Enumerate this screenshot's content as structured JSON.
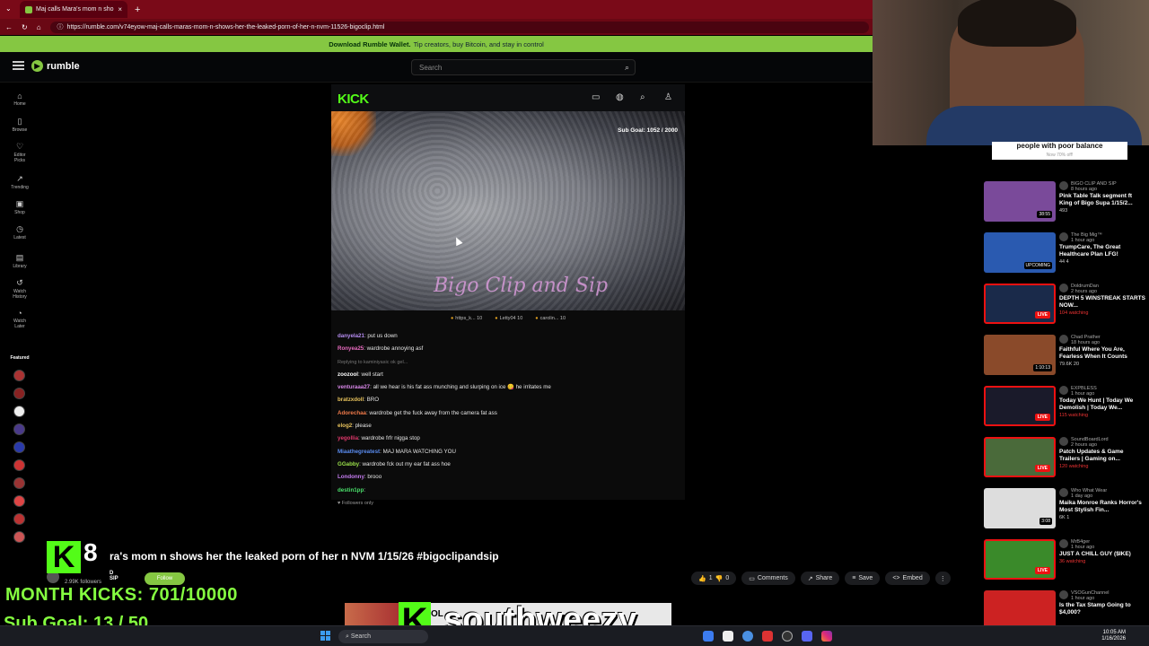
{
  "browser": {
    "tab_title": "Maj calls Mara's mom n sho",
    "url": "https://rumble.com/v74eyow-maj-calls-maras-mom-n-shows-her-the-leaked-porn-of-her-n-nvm-11526-bigoclip.html"
  },
  "banner": {
    "bold": "Download Rumble Wallet.",
    "text": "Tip creators, buy Bitcoin, and stay in control"
  },
  "header": {
    "logo": "rumble",
    "search_placeholder": "Search"
  },
  "sidebar": {
    "items": [
      {
        "label": "Home",
        "icon": "home-icon"
      },
      {
        "label": "Browse",
        "icon": "browse-icon"
      },
      {
        "label": "Editor Picks",
        "icon": "editor-picks-icon"
      },
      {
        "label": "Trending",
        "icon": "trending-icon"
      },
      {
        "label": "Shop",
        "icon": "shop-icon"
      },
      {
        "label": "Latest",
        "icon": "latest-icon"
      },
      {
        "label": "Library",
        "icon": "library-icon"
      },
      {
        "label": "Watch History",
        "icon": "history-icon"
      },
      {
        "label": "Watch Later",
        "icon": "watch-later-icon"
      }
    ],
    "featured": "Featured"
  },
  "player": {
    "kick_logo": "KICK",
    "sub_goal": "Sub Goal:  1052 / 2000",
    "watermark": "Bigo Clip and Sip",
    "gifters": [
      "https_k... 10",
      "Letty04  10",
      "carolin...  10"
    ],
    "chat": [
      {
        "user": "danyela21",
        "color": "#b58cf0",
        "msg": ": put us down"
      },
      {
        "user": "Ronyea25",
        "color": "#e86bbf",
        "msg": ": wardrobe annoying asf"
      },
      {
        "sys": "Replying to kaminiyasic ok gel..."
      },
      {
        "user": "zoozool",
        "color": "#ffffff",
        "msg": ": well start"
      },
      {
        "user": "venturaaa27",
        "color": "#d887e8",
        "msg": ": all we hear is his fat ass munching and slurping on ice 😋 he irritates me"
      },
      {
        "user": "bratzxdoll",
        "color": "#e8c35c",
        "msg": ": BRO"
      },
      {
        "user": "Adorechaa",
        "color": "#f07a4a",
        "msg": ": wardrobe get the fuck away from the camera fat ass"
      },
      {
        "user": "elog2",
        "color": "#e8c35c",
        "msg": ": please"
      },
      {
        "user": "yegollia",
        "color": "#e0386b",
        "msg": ": wardrobe frfr nigga stop"
      },
      {
        "user": "Miaathegreatest",
        "color": "#5a8cf0",
        "msg": ": MAJ MARA WATCHING YOU"
      },
      {
        "user": "GGabby",
        "color": "#9ae04a",
        "msg": ": wardrobe fck out my ear fat ass hoe"
      },
      {
        "user": "Londonny",
        "color": "#c57cf0",
        "msg": ": brooo"
      },
      {
        "user": "destin1pp",
        "color": "#4ae06b",
        "msg": ":"
      }
    ],
    "followers_only": "Followers only"
  },
  "video": {
    "title": "ra's mom n shows her the leaked porn of her n NVM 1/15/26 #bigoclipandsip",
    "channel": "D SIP",
    "followers": "2.99K followers",
    "follow_label": "Follow",
    "likes": "1",
    "dislikes": "0",
    "actions": {
      "comments": "Comments",
      "share": "Share",
      "save": "Save",
      "embed": "Embed"
    }
  },
  "overlay": {
    "k": "K",
    "count": "8",
    "month_kicks": "MONTH KICKS: 701/10000",
    "sub_goal": "Sub Goal:  13 / 50",
    "streamer": "southweezy",
    "notice_partial": "OL"
  },
  "ad": {
    "text": "people with poor balance",
    "sub": "Now 70% off!"
  },
  "recommended": [
    {
      "channel": "BIGO CLIP AND SIP",
      "time": "8 hours ago",
      "title": "Pink Table Talk segment ft King of Bigo Supa 1/15/2...",
      "stats": "493",
      "badge": "38:55",
      "live": false,
      "thumb": "#7a4a9a"
    },
    {
      "channel": "The Big Mig™",
      "time": "1 hour ago",
      "title": "TrumpCare, The Great Healthcare Plan LFG!",
      "stats": "44   4",
      "badge": "UPCOMING",
      "live": false,
      "thumb": "#2a5ab0"
    },
    {
      "channel": "DoldrumDan",
      "time": "2 hours ago",
      "title": "DEPTH 5 WINSTREAK STARTS NOW...",
      "stats": "104 watching",
      "badge": "LIVE",
      "live": true,
      "thumb": "#1a2a4a"
    },
    {
      "channel": "Chad Prather",
      "time": "18 hours ago",
      "title": "Faithful Where You Are, Fearless When It Counts",
      "stats": "79.6K   20",
      "badge": "1:10:13",
      "live": false,
      "thumb": "#8a4a2a"
    },
    {
      "channel": "EXPBLESS",
      "time": "1 hour ago",
      "title": "Today We Hunt | Today We Demolish | Today We...",
      "stats": "115 watching",
      "badge": "LIVE",
      "live": true,
      "thumb": "#1a1a2a"
    },
    {
      "channel": "SoundBoardLord",
      "time": "2 hours ago",
      "title": "Patch Updates & Game Trailers | Gaming on...",
      "stats": "120 watching",
      "badge": "LIVE",
      "live": true,
      "thumb": "#4a6a3a"
    },
    {
      "channel": "Who What Wear",
      "time": "1 day ago",
      "title": "Maika Monroe Ranks Horror's Most Stylish Fin...",
      "stats": "6K   1",
      "badge": "3:08",
      "live": false,
      "thumb": "#ddd"
    },
    {
      "channel": "MrB4ger",
      "time": "1 hour ago",
      "title": "JUST A CHILL GUY ($IKE)",
      "stats": "36 watching",
      "badge": "LIVE",
      "live": true,
      "thumb": "#3a8a2a"
    },
    {
      "channel": "VSOGunChannel",
      "time": "1 hour ago",
      "title": "Is the Tax Stamp Going to $4,000?",
      "stats": "",
      "badge": "",
      "live": false,
      "thumb": "#c22"
    }
  ],
  "taskbar": {
    "search": "Search",
    "time": "10:05 AM",
    "date": "1/16/2026"
  }
}
